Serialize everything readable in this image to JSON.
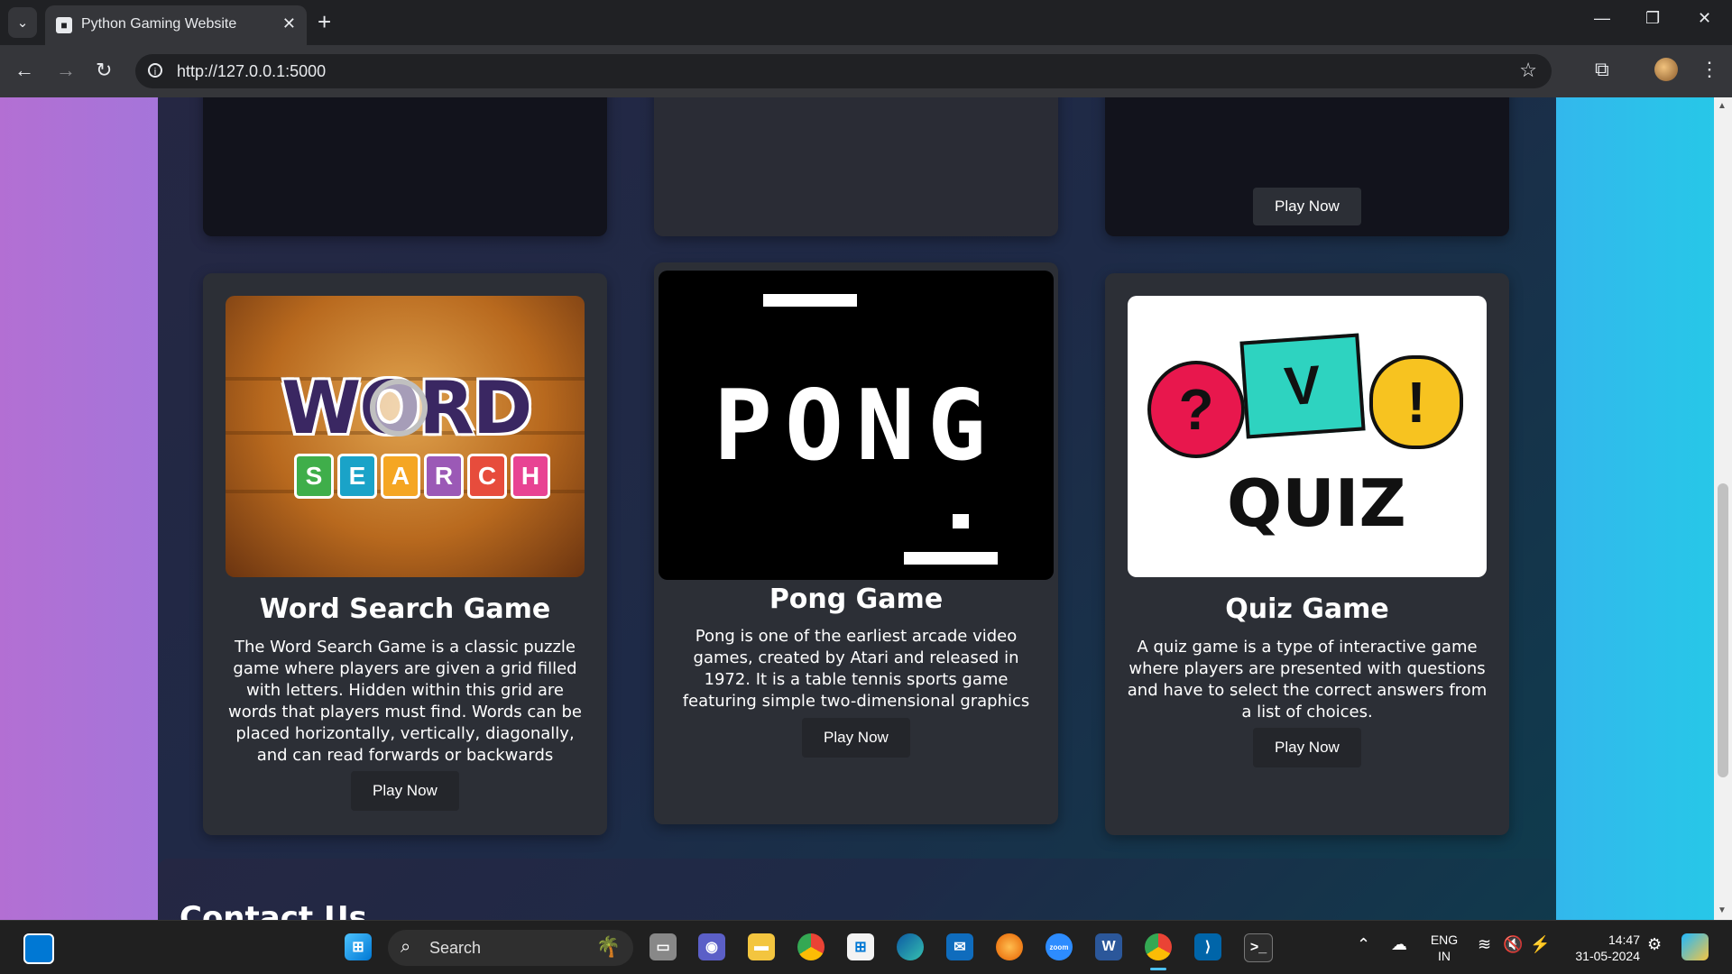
{
  "browser": {
    "tab_title": "Python Gaming Website",
    "url": "http://127.0.0.1:5000"
  },
  "top_row": {
    "visible_button_label": "Play Now"
  },
  "games": [
    {
      "title": "Word Search Game",
      "description": "The Word Search Game is a classic puzzle game where players are given a grid filled with letters. Hidden within this grid are words that players must find. Words can be placed horizontally, vertically, diagonally, and can read forwards or backwards",
      "button": "Play Now",
      "image_word_top": "WORD",
      "image_letters": [
        "S",
        "E",
        "A",
        "R",
        "C",
        "H"
      ]
    },
    {
      "title": "Pong Game",
      "description": "Pong is one of the earliest arcade video games, created by Atari and released in 1972. It is a table tennis sports game featuring simple two-dimensional graphics",
      "button": "Play Now",
      "image_text": "PONG"
    },
    {
      "title": "Quiz Game",
      "description": "A quiz game is a type of interactive game where players are presented with questions and have to select the correct answers from a list of choices.",
      "button": "Play Now",
      "image_text": "QUIZ",
      "image_marks": [
        "?",
        "V",
        "!"
      ]
    }
  ],
  "contact": {
    "heading": "Contact Us"
  },
  "taskbar": {
    "search_label": "Search",
    "lang_line1": "ENG",
    "lang_line2": "IN",
    "time": "14:47",
    "date": "31-05-2024"
  },
  "colors": {
    "page_gradient": [
      "#b36fd3",
      "#6f8cf4",
      "#27c7e8"
    ],
    "panel": "#1e2a47",
    "card": "#2c2f36",
    "button": "#24262b"
  }
}
